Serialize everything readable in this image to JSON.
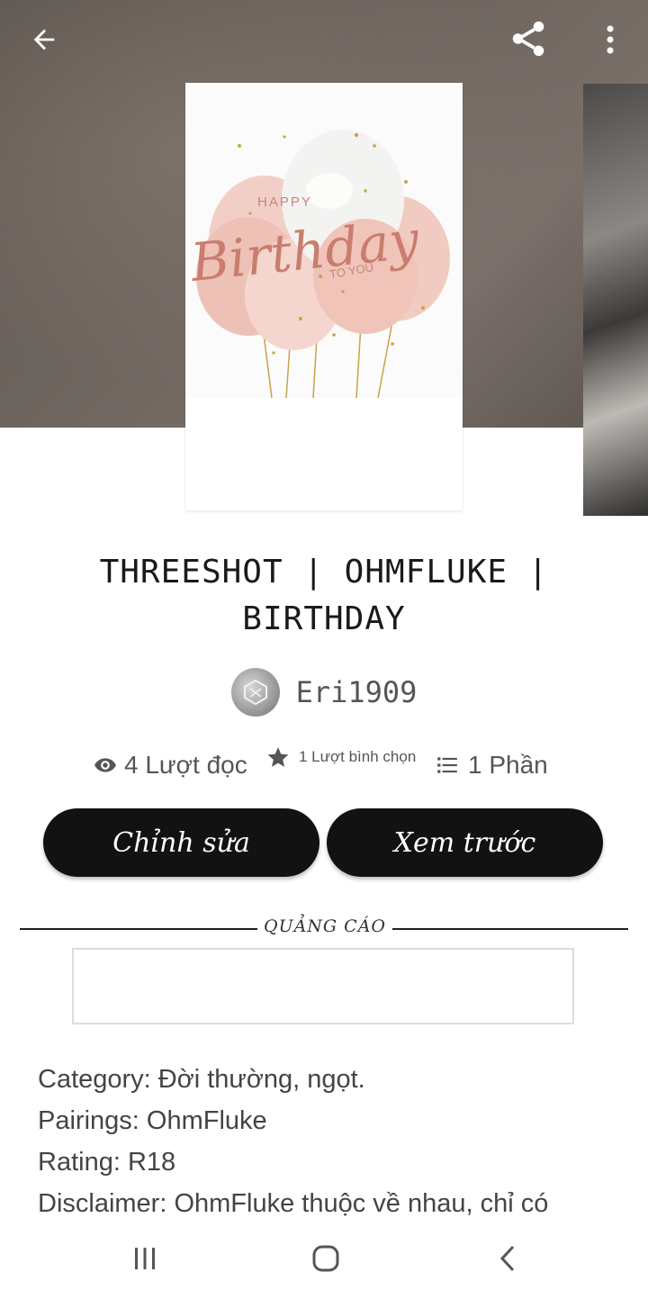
{
  "cover": {
    "line1": "HAPPY",
    "line2": "Birthday",
    "line3": "TO YOU"
  },
  "story": {
    "title": "THREESHOT | OHMFLUKE | BIRTHDAY",
    "author": "Eri1909"
  },
  "stats": {
    "reads": "4 Lượt đọc",
    "votes": "1 Lượt bình chọn",
    "parts": "1 Phần"
  },
  "actions": {
    "edit_label": "Chỉnh sửa",
    "preview_label": "Xem trước"
  },
  "ad": {
    "label": "QUẢNG CÁO"
  },
  "description": [
    "Category: Đời thường, ngọt.",
    "Pairings: OhmFluke",
    "Rating: R18",
    "Disclaimer: OhmFluke thuộc về nhau, chỉ có"
  ],
  "icons": {
    "back": "arrow-left-icon",
    "share": "share-icon",
    "more": "more-vertical-icon",
    "reads": "eye-icon",
    "votes": "star-icon",
    "parts": "list-icon",
    "nav_recent": "recent-apps-icon",
    "nav_home": "home-icon",
    "nav_back": "chevron-left-icon"
  },
  "colors": {
    "button_bg": "#121212",
    "button_text": "#ffffff",
    "cover_pink": "#e7a89e",
    "cover_gold": "#c9a24a"
  }
}
